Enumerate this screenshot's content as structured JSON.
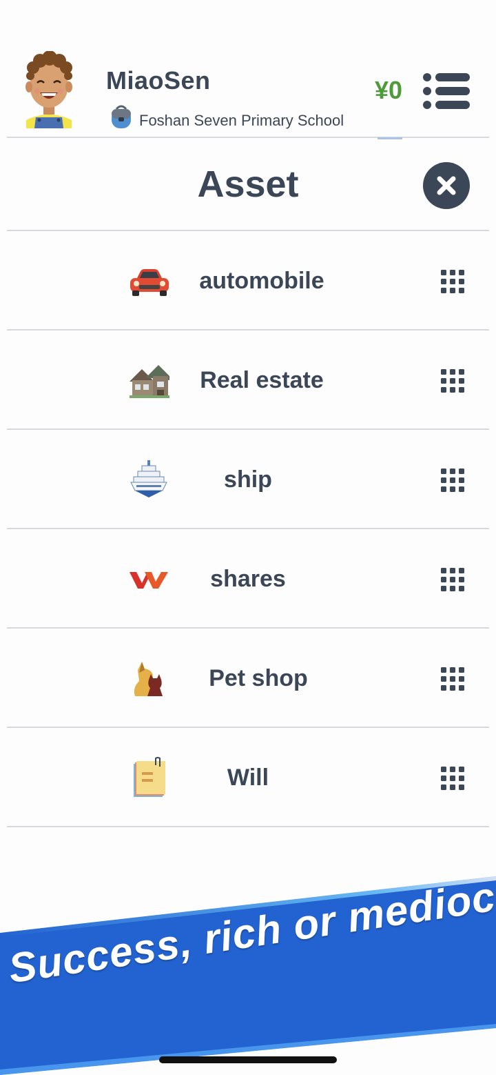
{
  "header": {
    "username": "MiaoSen",
    "school": "Foshan Seven Primary School",
    "balance": "¥0"
  },
  "panel": {
    "title": "Asset"
  },
  "assets": [
    {
      "label": "automobile",
      "icon": "car-icon"
    },
    {
      "label": "Real estate",
      "icon": "house-icon"
    },
    {
      "label": "ship",
      "icon": "ship-icon"
    },
    {
      "label": "shares",
      "icon": "shares-icon"
    },
    {
      "label": "Pet shop",
      "icon": "pet-icon"
    },
    {
      "label": "Will",
      "icon": "will-notepad-icon"
    }
  ],
  "banner": {
    "slogan": "Success, rich or mediocre"
  },
  "colors": {
    "text": "#3b4657",
    "balance": "#4f9a3a",
    "banner": "#2363d1",
    "divider": "#d7dade"
  }
}
